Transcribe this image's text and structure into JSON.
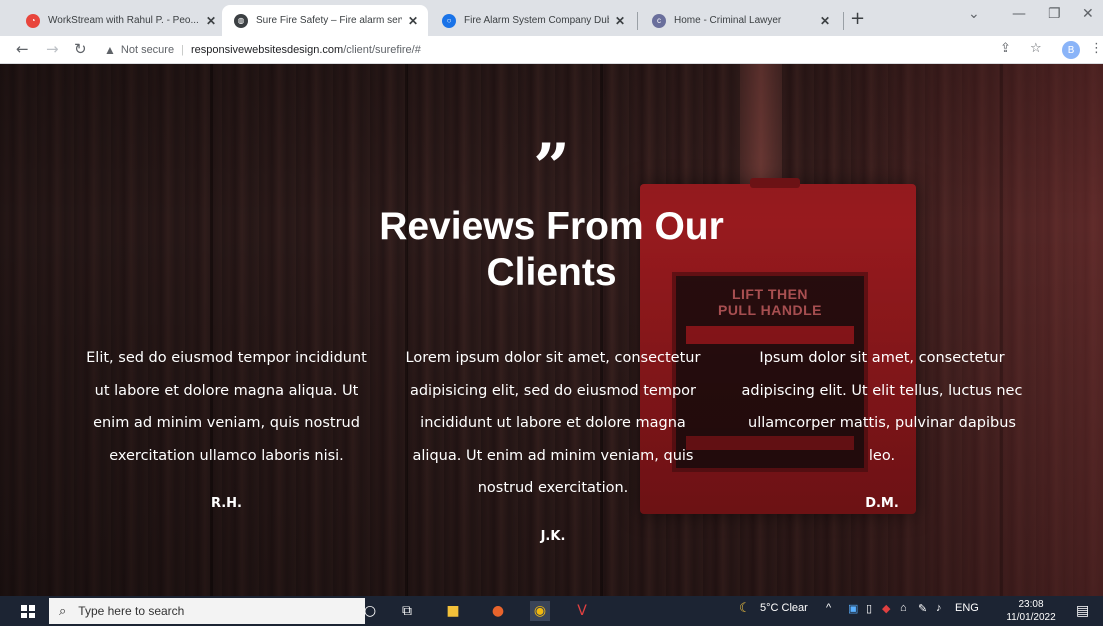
{
  "browser": {
    "tabs": [
      {
        "title": "WorkStream with Rahul P. - Peo...",
        "close": "✕",
        "favicon_color": "#e8453c"
      },
      {
        "title": "Sure Fire Safety – Fire alarm servi...",
        "close": "✕",
        "favicon_color": "#3c4043"
      },
      {
        "title": "Fire Alarm System Company Dub...",
        "close": "✕",
        "favicon_color": "#1a73e8"
      },
      {
        "title": "Home - Criminal Lawyer",
        "close": "✕",
        "favicon_color": "#6a6f9c"
      }
    ],
    "new_tab": "+",
    "address": {
      "security_label": "Not secure",
      "host": "responsivewebsitesdesign.com",
      "path": "/client/surefire/#"
    },
    "profile_initial": "B"
  },
  "page": {
    "quote_mark": "”",
    "heading_line1": "Reviews From Our",
    "heading_line2": "Clients",
    "alarm_text_line1": "LIFT THEN",
    "alarm_text_line2": "PULL HANDLE",
    "reviews": [
      {
        "text": "Elit, sed do eiusmod tempor incididunt ut labore et dolore magna aliqua. Ut enim ad minim veniam, quis nostrud exercitation ullamco laboris nisi.",
        "author": "R.H."
      },
      {
        "text": "Lorem ipsum dolor sit amet, consectetur adipisicing elit, sed do eiusmod tempor incididunt ut labore et dolore magna aliqua. Ut enim ad minim veniam, quis nostrud exercitation.",
        "author": "J.K."
      },
      {
        "text": "Ipsum dolor sit amet, consectetur adipiscing elit. Ut elit tellus, luctus nec ullamcorper mattis, pulvinar dapibus leo.",
        "author": "D.M."
      }
    ]
  },
  "taskbar": {
    "search_placeholder": "Type here to search",
    "weather": "5°C  Clear",
    "language": "ENG",
    "time": "23:08",
    "date": "11/01/2022"
  },
  "colors": {
    "accent_red": "#c21f24",
    "taskbar_bg": "#1c2433"
  }
}
